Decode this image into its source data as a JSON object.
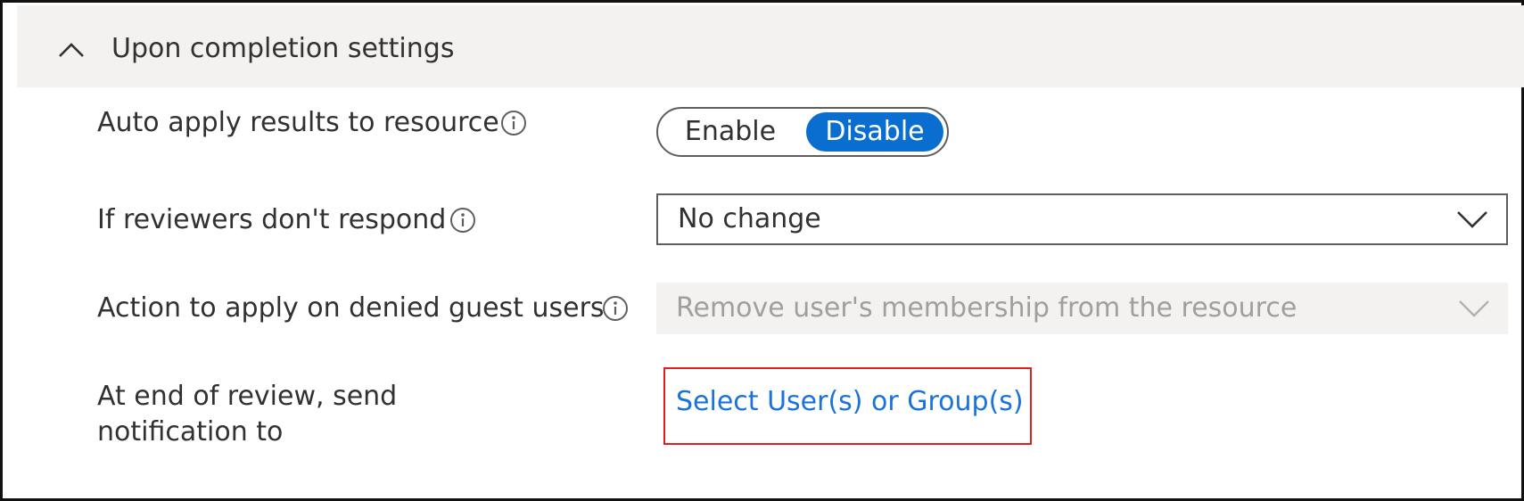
{
  "section": {
    "title": "Upon completion settings",
    "collapse_icon": "chevron-up-icon"
  },
  "rows": {
    "auto_apply": {
      "label": "Auto apply results to resource",
      "info_icon": "info-icon",
      "toggle": {
        "options": [
          "Enable",
          "Disable"
        ],
        "selected": "Disable"
      }
    },
    "no_response": {
      "label": "If reviewers don't respond",
      "info_icon": "info-icon",
      "dropdown_value": "No change",
      "dropdown_icon": "chevron-down-icon"
    },
    "denied_guests": {
      "label": "Action to apply on denied guest users",
      "info_icon": "info-icon",
      "dropdown_value": "Remove user's membership from the resource",
      "disabled": true,
      "dropdown_icon": "chevron-down-icon"
    },
    "notify": {
      "label_line1": "At end of review, send",
      "label_line2": "notification to",
      "link_text": "Select User(s) or Group(s)"
    }
  },
  "colors": {
    "accent": "#0a6ed1",
    "link": "#1a73d9",
    "highlight_box": "#e02020",
    "header_bg": "#f3f2f1",
    "disabled_text": "#a19f9d"
  }
}
